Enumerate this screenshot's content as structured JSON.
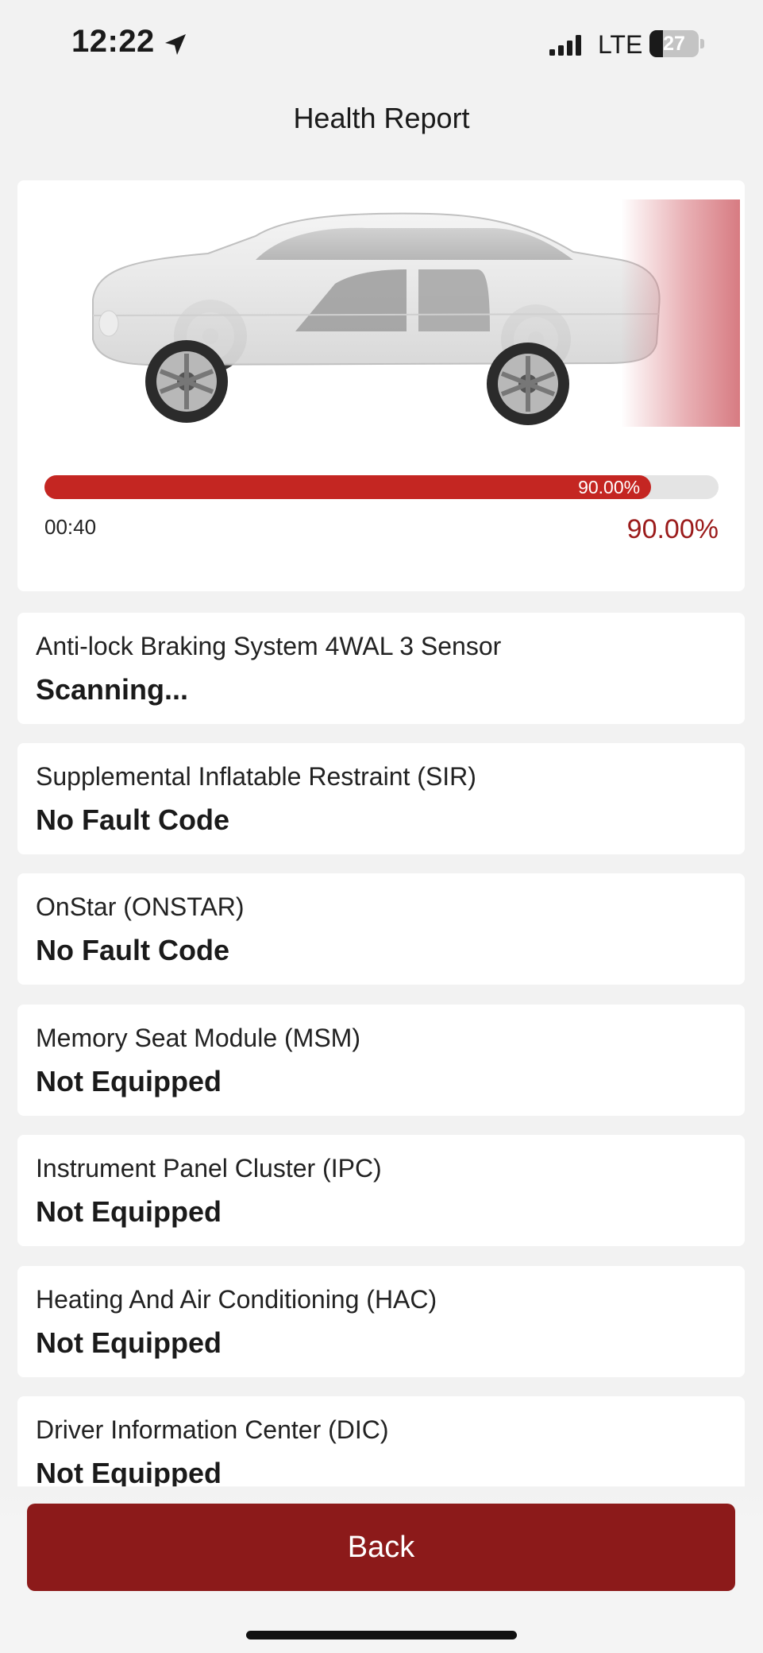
{
  "status_bar": {
    "time": "12:22",
    "network": "LTE",
    "battery": "27",
    "battery_level": 0.27
  },
  "header": {
    "title": "Health Report"
  },
  "scan": {
    "progress": 0.9,
    "progress_label": "90.00%",
    "elapsed": "00:40",
    "percent": "90.00%",
    "accent_color": "#c42622"
  },
  "modules": [
    {
      "name": "Anti-lock Braking System 4WAL 3 Sensor",
      "status": "Scanning..."
    },
    {
      "name": "Supplemental Inflatable Restraint (SIR)",
      "status": "No Fault Code"
    },
    {
      "name": "OnStar (ONSTAR)",
      "status": "No Fault Code"
    },
    {
      "name": "Memory Seat Module (MSM)",
      "status": "Not Equipped"
    },
    {
      "name": "Instrument Panel Cluster (IPC)",
      "status": "Not Equipped"
    },
    {
      "name": "Heating And Air Conditioning (HAC)",
      "status": "Not Equipped"
    },
    {
      "name": "Driver Information Center (DIC)",
      "status": "Not Equipped"
    }
  ],
  "footer": {
    "back_label": "Back",
    "button_color": "#8c1a1a"
  }
}
